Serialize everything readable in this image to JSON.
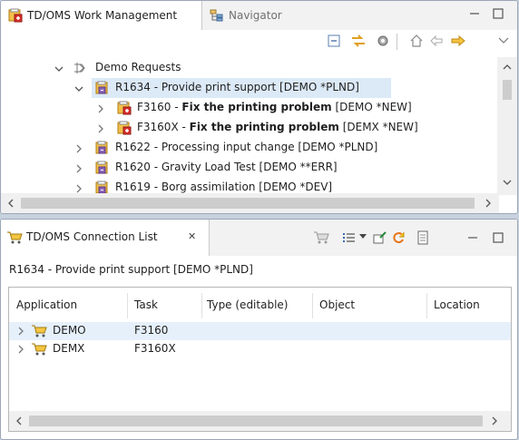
{
  "top_view": {
    "tabs": [
      {
        "label": "TD/OMS Work Management",
        "icon": "work-management-icon",
        "active": true
      },
      {
        "label": "Navigator",
        "icon": "navigator-icon",
        "active": false
      }
    ],
    "window_controls": [
      "minimize-icon",
      "maximize-icon"
    ],
    "toolbar": [
      "collapse-all-icon",
      "link-with-editor-icon",
      "settings-gear-icon",
      "home-icon",
      "back-arrow-icon",
      "forward-arrow-icon",
      "view-menu-icon"
    ],
    "tree": [
      {
        "level": 0,
        "expanded": true,
        "icon": "folder-request-icon",
        "text": "Demo Requests",
        "bold": "",
        "suffix": ""
      },
      {
        "level": 1,
        "expanded": true,
        "icon": "request-icon",
        "text": "R1634 - Provide print support [DEMO *PLND]",
        "bold": "",
        "suffix": "",
        "selected": true
      },
      {
        "level": 2,
        "expanded": false,
        "icon": "request-icon",
        "text": "F3160 - ",
        "bold": "Fix the printing problem",
        "suffix": " [DEMO *NEW]"
      },
      {
        "level": 2,
        "expanded": false,
        "icon": "request-icon",
        "text": "F3160X - ",
        "bold": "Fix the printing problem",
        "suffix": " [DEMX *NEW]"
      },
      {
        "level": 1,
        "expanded": false,
        "icon": "request-icon",
        "text": "R1622 - Processing input change [DEMO *PLND]",
        "bold": "",
        "suffix": ""
      },
      {
        "level": 1,
        "expanded": false,
        "icon": "request-icon",
        "text": "R1620 - Gravity Load Test [DEMO **ERR]",
        "bold": "",
        "suffix": ""
      },
      {
        "level": 1,
        "expanded": false,
        "icon": "request-icon",
        "text": "R1619 - Borg assimilation [DEMO *DEV]",
        "bold": "",
        "suffix": ""
      }
    ]
  },
  "bottom_view": {
    "tab": {
      "label": "TD/OMS Connection List",
      "close": "✕",
      "icon": "connection-list-icon"
    },
    "toolbar": [
      "cart-icon",
      "list-menu-icon",
      "dropdown-arrow-icon",
      "edit-connection-icon",
      "refresh-icon",
      "document-icon",
      "minimize-icon",
      "maximize-icon"
    ],
    "context": "R1634 - Provide print support [DEMO *PLND]",
    "table": {
      "columns": [
        "Application",
        "Task",
        "Type (editable)",
        "Object",
        "Location"
      ],
      "rows": [
        {
          "application": "DEMO",
          "task": "F3160",
          "type": "",
          "object": "",
          "location": ""
        },
        {
          "application": "DEMX",
          "task": "F3160X",
          "type": "",
          "object": "",
          "location": ""
        }
      ]
    }
  },
  "colors": {
    "selection": "#dce9f7",
    "row_highlight": "#e6f0fb",
    "accent_orange": "#e8731a",
    "accent_yellow": "#f0c419"
  }
}
